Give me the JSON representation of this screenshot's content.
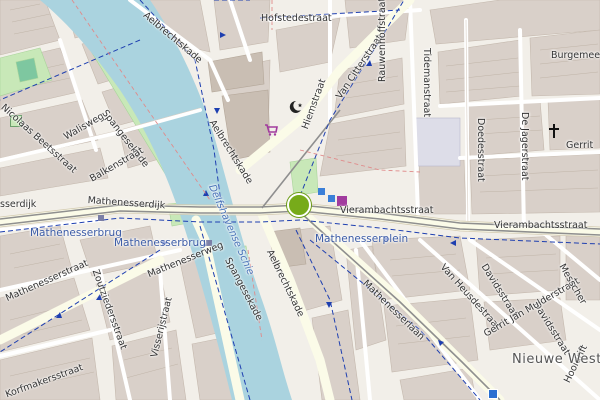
{
  "colors": {
    "background": "#f2efe9",
    "block": "#d9d0c9",
    "building": "#c9beb3",
    "water": "#aad3df",
    "park": "#c8e8b8",
    "road_major": "#f8f8ec",
    "road_minor": "#ffffff",
    "rail": "#8f8f8f",
    "bus_route": "#1e3fb0",
    "poi": "#7b3f99",
    "marker": "#77ab1a"
  },
  "streets": {
    "hofstedestraat": "Hofstedestraat",
    "aelbrechtskade_n": "Aelbrechtskade",
    "aelbrechtskade_mid": "Aelbrechtskade",
    "aelbrechtskade_s": "Aelbrechtskade",
    "van_citterstraat": "Van Citterstraat",
    "tidemanstraat": "Tidemanstraat",
    "burgemeester": "Burgemeester",
    "nicolaas_beetsstraat": "Nicolaas Beetsstraat",
    "walisweg": "Walisweg",
    "spangesekade_n": "Spangesekade",
    "spangesekade_s": "Spangesekade",
    "balkenstraat": "Balkenstraat",
    "mathenesserdijk": "Mathenesserdijk",
    "ssersdijk": "sserdijk",
    "hiemstraat": "Hiemstraat",
    "rauwenhoffstraat": "Rauwenhoffstraat",
    "doedesstraat": "Doedesstraat",
    "de_jagerstraat": "De Jagerstraat",
    "gerrit": "Gerrit",
    "vierambachtsstraat_1": "Vierambachtsstraat",
    "vierambachtsstraat_2": "Vierambachtsstraat",
    "mathenesserweg": "Mathenesserweg",
    "mathenesserstraat": "Mathenesserstraat",
    "zoutziedersstraat": "Zoutziedersstraat",
    "korfmakersstraat": "Korfmakersstraat",
    "visserijstraat": "Visserijstraat",
    "van_heusdestraat": "Van Heusdestraat",
    "davidsstraat_1": "Davidsstraat",
    "davidsstraat_2": "Davidsstraat",
    "gerrit_jan_mulderstraat": "Gerrit Jan Mulderstraat",
    "messcher": "Messcher",
    "hooidrift": "Hooidrift",
    "mathenesserlaan": "Mathenesserlaan",
    "schie": "De Schie",
    "delfshavense_schie": "Delfshavense Schie"
  },
  "transit": {
    "mathenesserbrug_1": "Mathenesserbrug",
    "mathenesserbrug_2": "Mathenesserbrug",
    "mathenesserplein": "Mathenesserplein"
  },
  "districts": {
    "nieuwe_westen": "Nieuwe Weste"
  },
  "icons": {
    "mosque": "star-and-crescent-icon",
    "shop": "shopping-cart-icon",
    "church": "cross-icon",
    "parking": "parking-icon",
    "toilet": "toilets-icon",
    "playground": "playground-icon",
    "tram_stop": "tram-stop-icon"
  }
}
